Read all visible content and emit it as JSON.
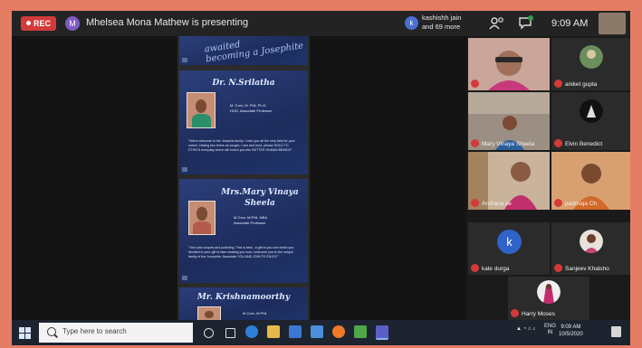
{
  "topbar": {
    "rec_label": "REC",
    "presenter_initial": "M",
    "presenting_text": "Mhelsea Mona Mathew is presenting",
    "host_initial": "k",
    "host_line1": "kashishh jain",
    "host_line2": "and 69 more",
    "time": "9:09 AM"
  },
  "slides": {
    "top_script_1": "awaited",
    "top_script_2": "becoming a Josephite",
    "slide1": {
      "title": "Dr. N.Srilatha",
      "info": [
        "M. Com, M. Phil, Ph.D",
        "HOD, Associate Professor"
      ],
      "quote": "\"Warm welcome to the Josephs family. I wish you all the very best for your career. Having two terms as sought, I see and trust, please HOLD TO ETHICS everyday which will enrich you into BETTER HUMAN BEINGS\""
    },
    "slide2": {
      "title": "Mrs.Mary Vinaya Sheela",
      "info": [
        "M.Com, M.Phil, MBA",
        "Associate Professor"
      ],
      "quote": "\"Your pick scopes and polishing. This is best - a gift to you one which you decided to your gift to take shaking you now I welcome you to the unique family of the Josephite, Associate YOU AND JOIN TO ENJOY\""
    },
    "slide3": {
      "title": "Mr. Krishnamoorthy",
      "info": [
        "M.Com, M.Phil"
      ]
    }
  },
  "participants": [
    {
      "name": ""
    },
    {
      "name": "aniket gupta"
    },
    {
      "name": "Mary Vinaya Sheela"
    },
    {
      "name": "Elvin Benedict"
    },
    {
      "name": "Archana se"
    },
    {
      "name": "padmaja Ch"
    },
    {
      "name": "kale durga",
      "initial": "k"
    },
    {
      "name": "Sanjeev Khalsho"
    },
    {
      "name": "Harry Moses"
    }
  ],
  "taskbar": {
    "search_placeholder": "Type here to search",
    "lang": "ENG",
    "region": "IN",
    "clock_time": "9:09 AM",
    "clock_date": "10/5/2020"
  },
  "colors": {
    "frame": "#e47d63",
    "rec": "#d33a3a",
    "slide_bg": "#1d2c5c",
    "mic_muted": "#d53a3a",
    "avatar_k": "#2f63c9"
  },
  "icons": [
    "record-dot-icon",
    "participants-icon",
    "chat-icon",
    "mic-muted-icon",
    "windows-start-icon",
    "search-icon",
    "task-view-icon",
    "edge-icon",
    "file-explorer-icon",
    "store-icon",
    "mail-icon",
    "firefox-icon",
    "teams-icon",
    "network-icon",
    "volume-icon",
    "notification-icon"
  ]
}
